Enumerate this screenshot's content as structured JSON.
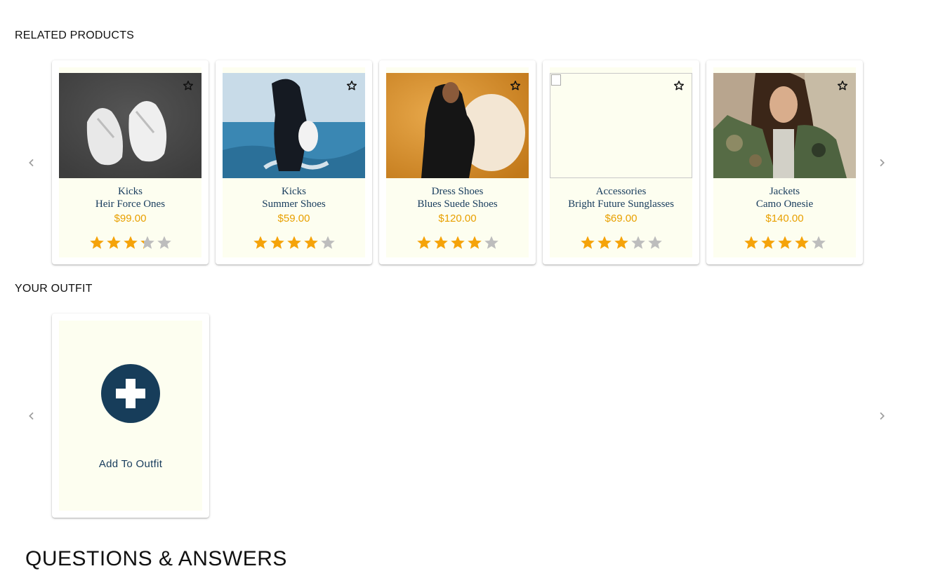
{
  "related": {
    "title": "RELATED PRODUCTS",
    "products": [
      {
        "category": "Kicks",
        "name": "Heir Force Ones",
        "price": "$99.00",
        "rating": 3.25,
        "image": "sneakers-photo"
      },
      {
        "category": "Kicks",
        "name": "Summer Shoes",
        "price": "$59.00",
        "rating": 4,
        "image": "ocean-photo"
      },
      {
        "category": "Dress Shoes",
        "name": "Blues Suede Shoes",
        "price": "$120.00",
        "rating": 4,
        "image": "fur-chair-photo"
      },
      {
        "category": "Accessories",
        "name": "Bright Future Sunglasses",
        "price": "$69.00",
        "rating": 3,
        "image": "broken-image"
      },
      {
        "category": "Jackets",
        "name": "Camo Onesie",
        "price": "$140.00",
        "rating": 4,
        "image": "camo-jacket-photo"
      }
    ]
  },
  "outfit": {
    "title": "YOUR OUTFIT",
    "add_label": "Add To Outfit"
  },
  "qa": {
    "title": "QUESTIONS & ANSWERS"
  },
  "colors": {
    "card_bg": "#fdfef0",
    "accent": "#173d5a",
    "price": "#e8a000",
    "star_filled": "#f5a30a",
    "star_empty": "#bdbdbd"
  },
  "icons": {
    "carousel_prev": "chevron-left-icon",
    "carousel_next": "chevron-right-icon",
    "favorite": "star-outline-icon",
    "add": "plus-circle-icon"
  }
}
